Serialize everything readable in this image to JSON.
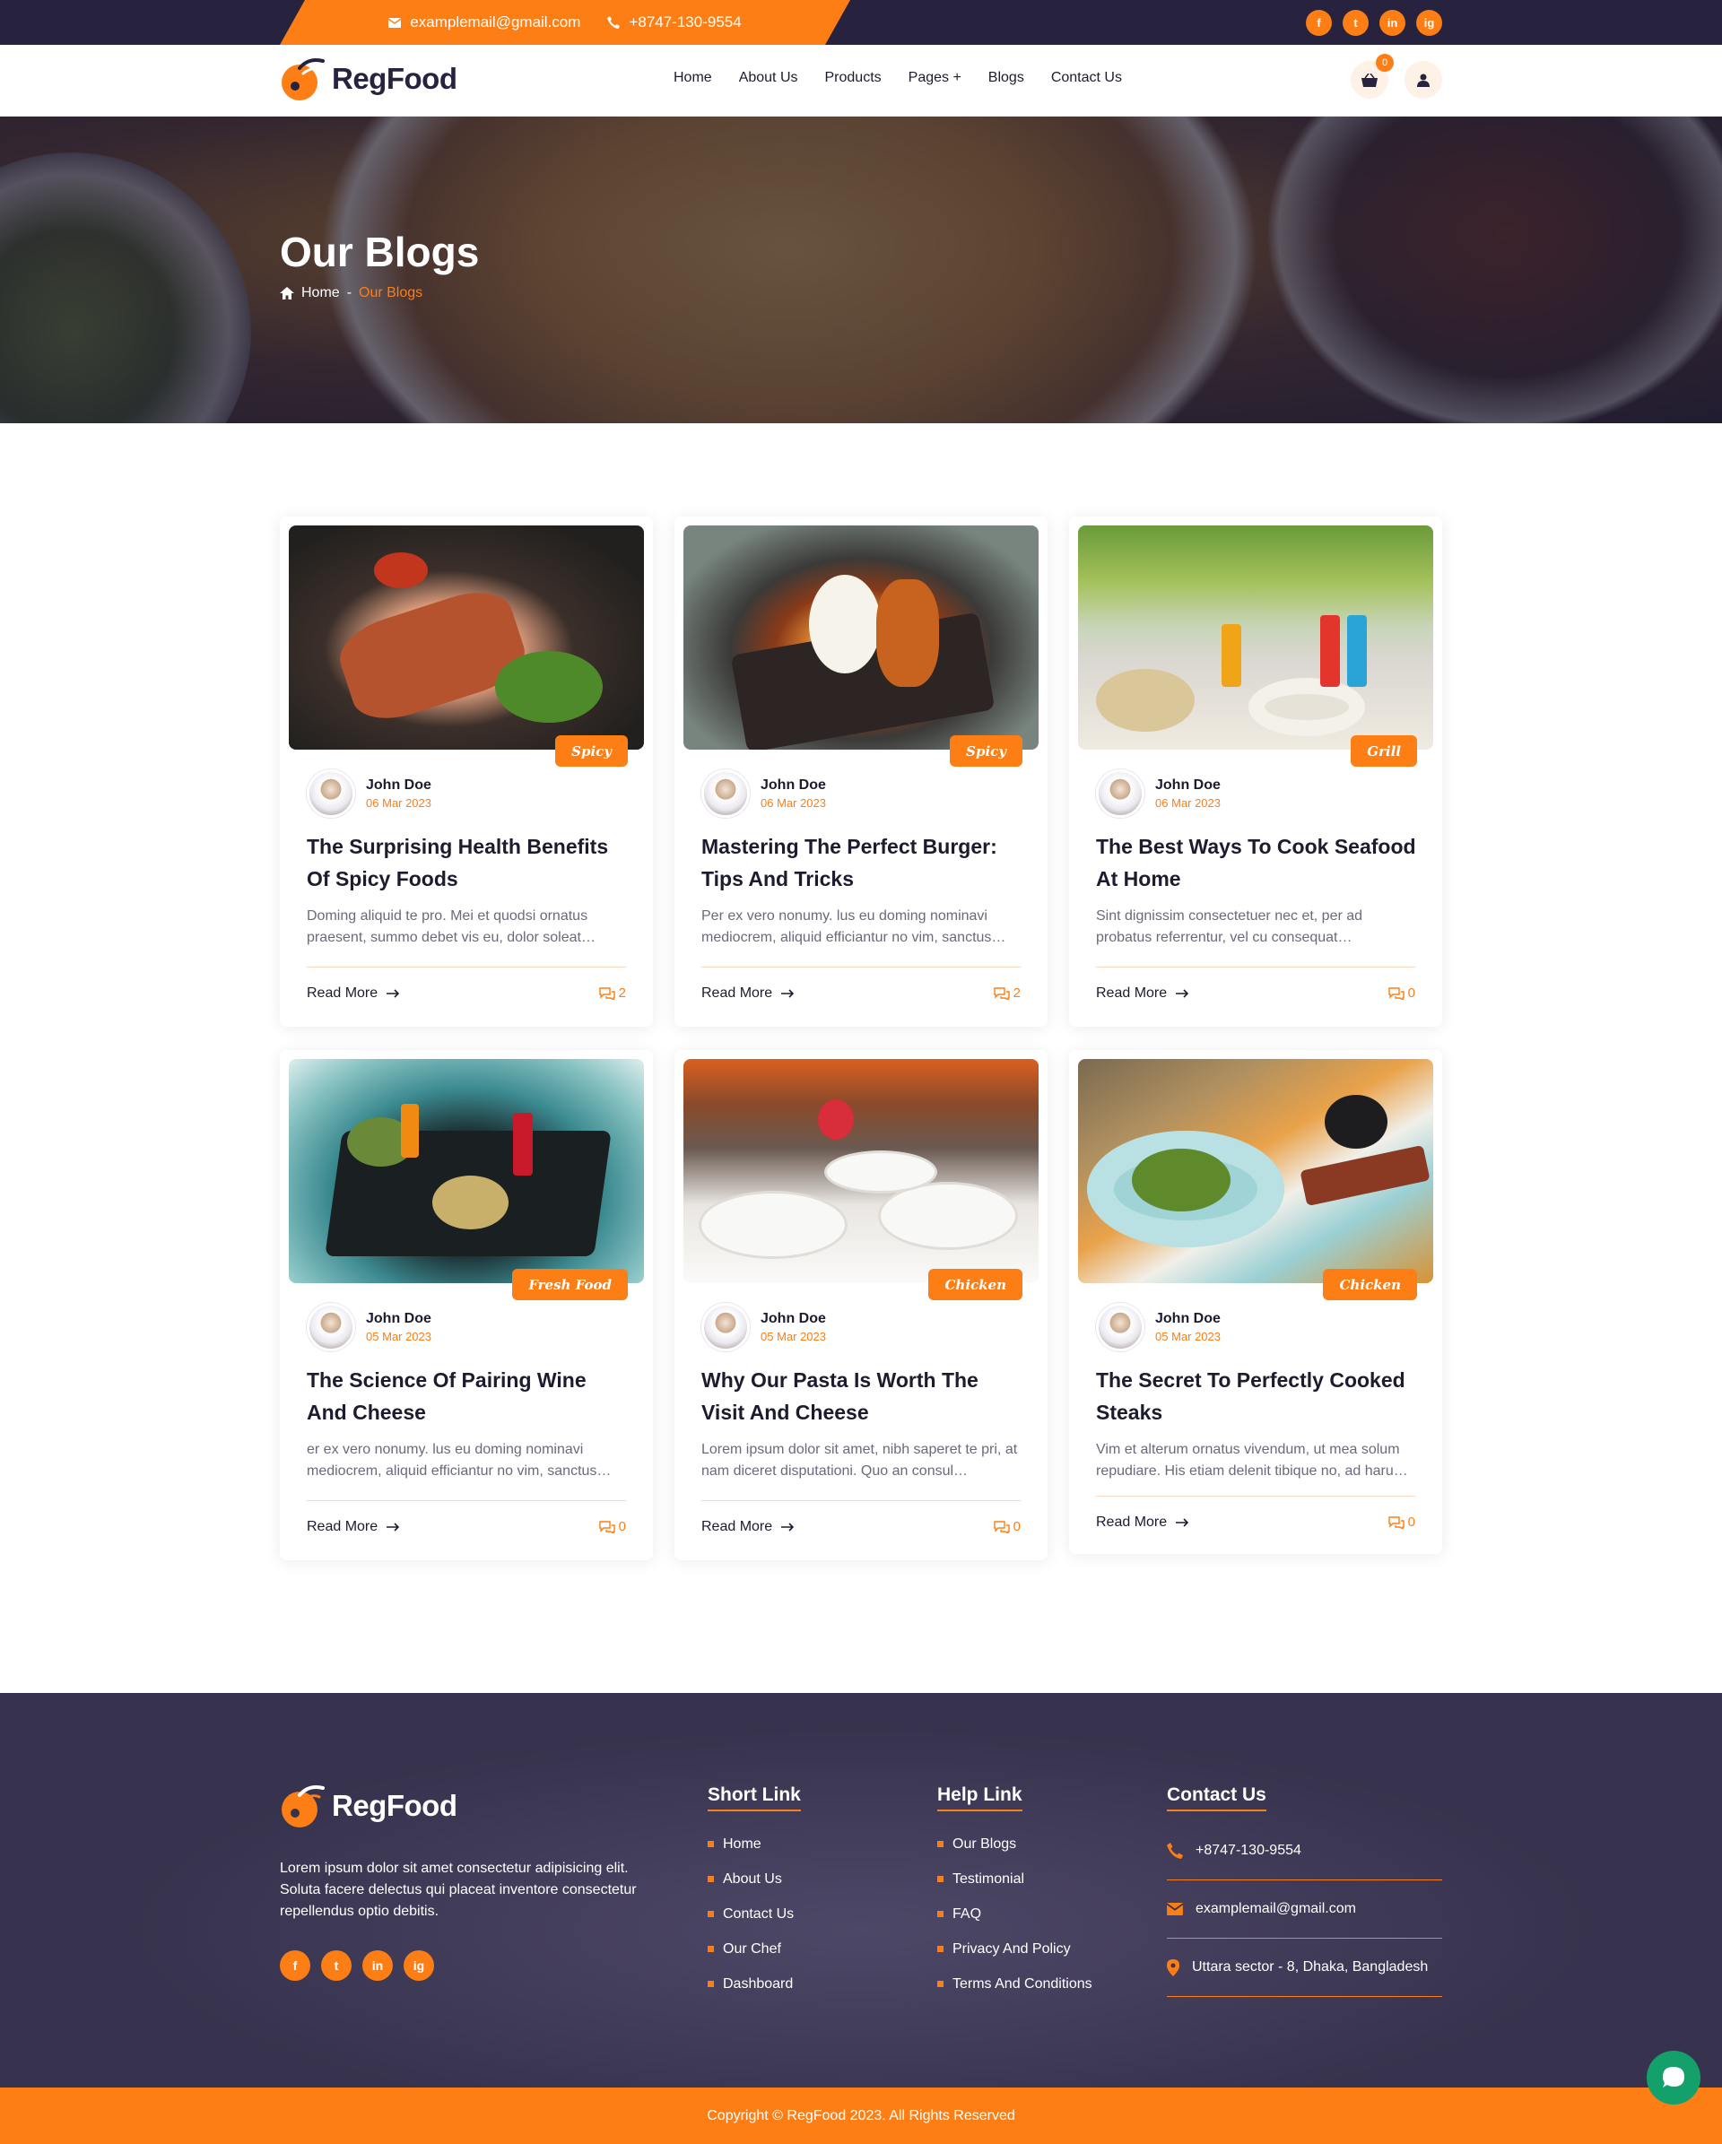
{
  "topbar": {
    "email": "examplemail@gmail.com",
    "phone": "+8747-130-9554",
    "social": [
      "f",
      "t",
      "in",
      "ig"
    ]
  },
  "header": {
    "logo_text": "RegFood",
    "nav": [
      "Home",
      "About Us",
      "Products",
      "Pages +",
      "Blogs",
      "Contact Us"
    ],
    "cart_count": "0"
  },
  "hero": {
    "title": "Our Blogs",
    "breadcrumb_home": "Home",
    "breadcrumb_sep": "-",
    "breadcrumb_current": "Our Blogs"
  },
  "posts": [
    {
      "tag": "Spicy",
      "author": "John Doe",
      "date": "06 Mar 2023",
      "title": "The Surprising Health Benefits Of Spicy Foods",
      "excerpt": "Doming aliquid te pro. Mei et quodsi ornatus praesent, summo debet vis eu, dolor soleat…",
      "read_more": "Read More",
      "comments": "2"
    },
    {
      "tag": "Spicy",
      "author": "John Doe",
      "date": "06 Mar 2023",
      "title": "Mastering The Perfect Burger: Tips And Tricks",
      "excerpt": "Per ex vero nonumy. lus eu doming nominavi mediocrem, aliquid efficiantur no vim, sanctus…",
      "read_more": "Read More",
      "comments": "2"
    },
    {
      "tag": "Grill",
      "author": "John Doe",
      "date": "06 Mar 2023",
      "title": "The Best Ways To Cook Seafood At Home",
      "excerpt": "Sint dignissim consectetuer nec et, per ad probatus referrentur, vel cu consequat…",
      "read_more": "Read More",
      "comments": "0"
    },
    {
      "tag": "Fresh Food",
      "author": "John Doe",
      "date": "05 Mar 2023",
      "title": "The Science Of Pairing Wine And Cheese",
      "excerpt": "er ex vero nonumy. lus eu doming nominavi mediocrem, aliquid efficiantur no vim, sanctus…",
      "read_more": "Read More",
      "comments": "0"
    },
    {
      "tag": "Chicken",
      "author": "John Doe",
      "date": "05 Mar 2023",
      "title": "Why Our Pasta Is Worth The Visit And Cheese",
      "excerpt": "Lorem ipsum dolor sit amet, nibh saperet te pri, at nam diceret disputationi. Quo an consul…",
      "read_more": "Read More",
      "comments": "0"
    },
    {
      "tag": "Chicken",
      "author": "John Doe",
      "date": "05 Mar 2023",
      "title": "The Secret To Perfectly Cooked Steaks",
      "excerpt": "Vim et alterum ornatus vivendum, ut mea solum repudiare. His etiam delenit tibique no, ad haru…",
      "read_more": "Read More",
      "comments": "0"
    }
  ],
  "footer": {
    "logo_text": "RegFood",
    "description": "Lorem ipsum dolor sit amet consectetur adipisicing elit. Soluta facere delectus qui placeat inventore consectetur repellendus optio debitis.",
    "short_link_title": "Short Link",
    "short_links": [
      "Home",
      "About Us",
      "Contact Us",
      "Our Chef",
      "Dashboard"
    ],
    "help_link_title": "Help Link",
    "help_links": [
      "Our Blogs",
      "Testimonial",
      "FAQ",
      "Privacy And Policy",
      "Terms And Conditions"
    ],
    "contact_title": "Contact Us",
    "contact_phone": "+8747-130-9554",
    "contact_email": "examplemail@gmail.com",
    "contact_address": "Uttara sector - 8, Dhaka, Bangladesh",
    "copyright": "Copyright © RegFood 2023. All Rights Reserved"
  },
  "colors": {
    "accent": "#fd7e14",
    "navy": "#27233f",
    "footer": "#37334e",
    "chat": "#13a06b"
  }
}
